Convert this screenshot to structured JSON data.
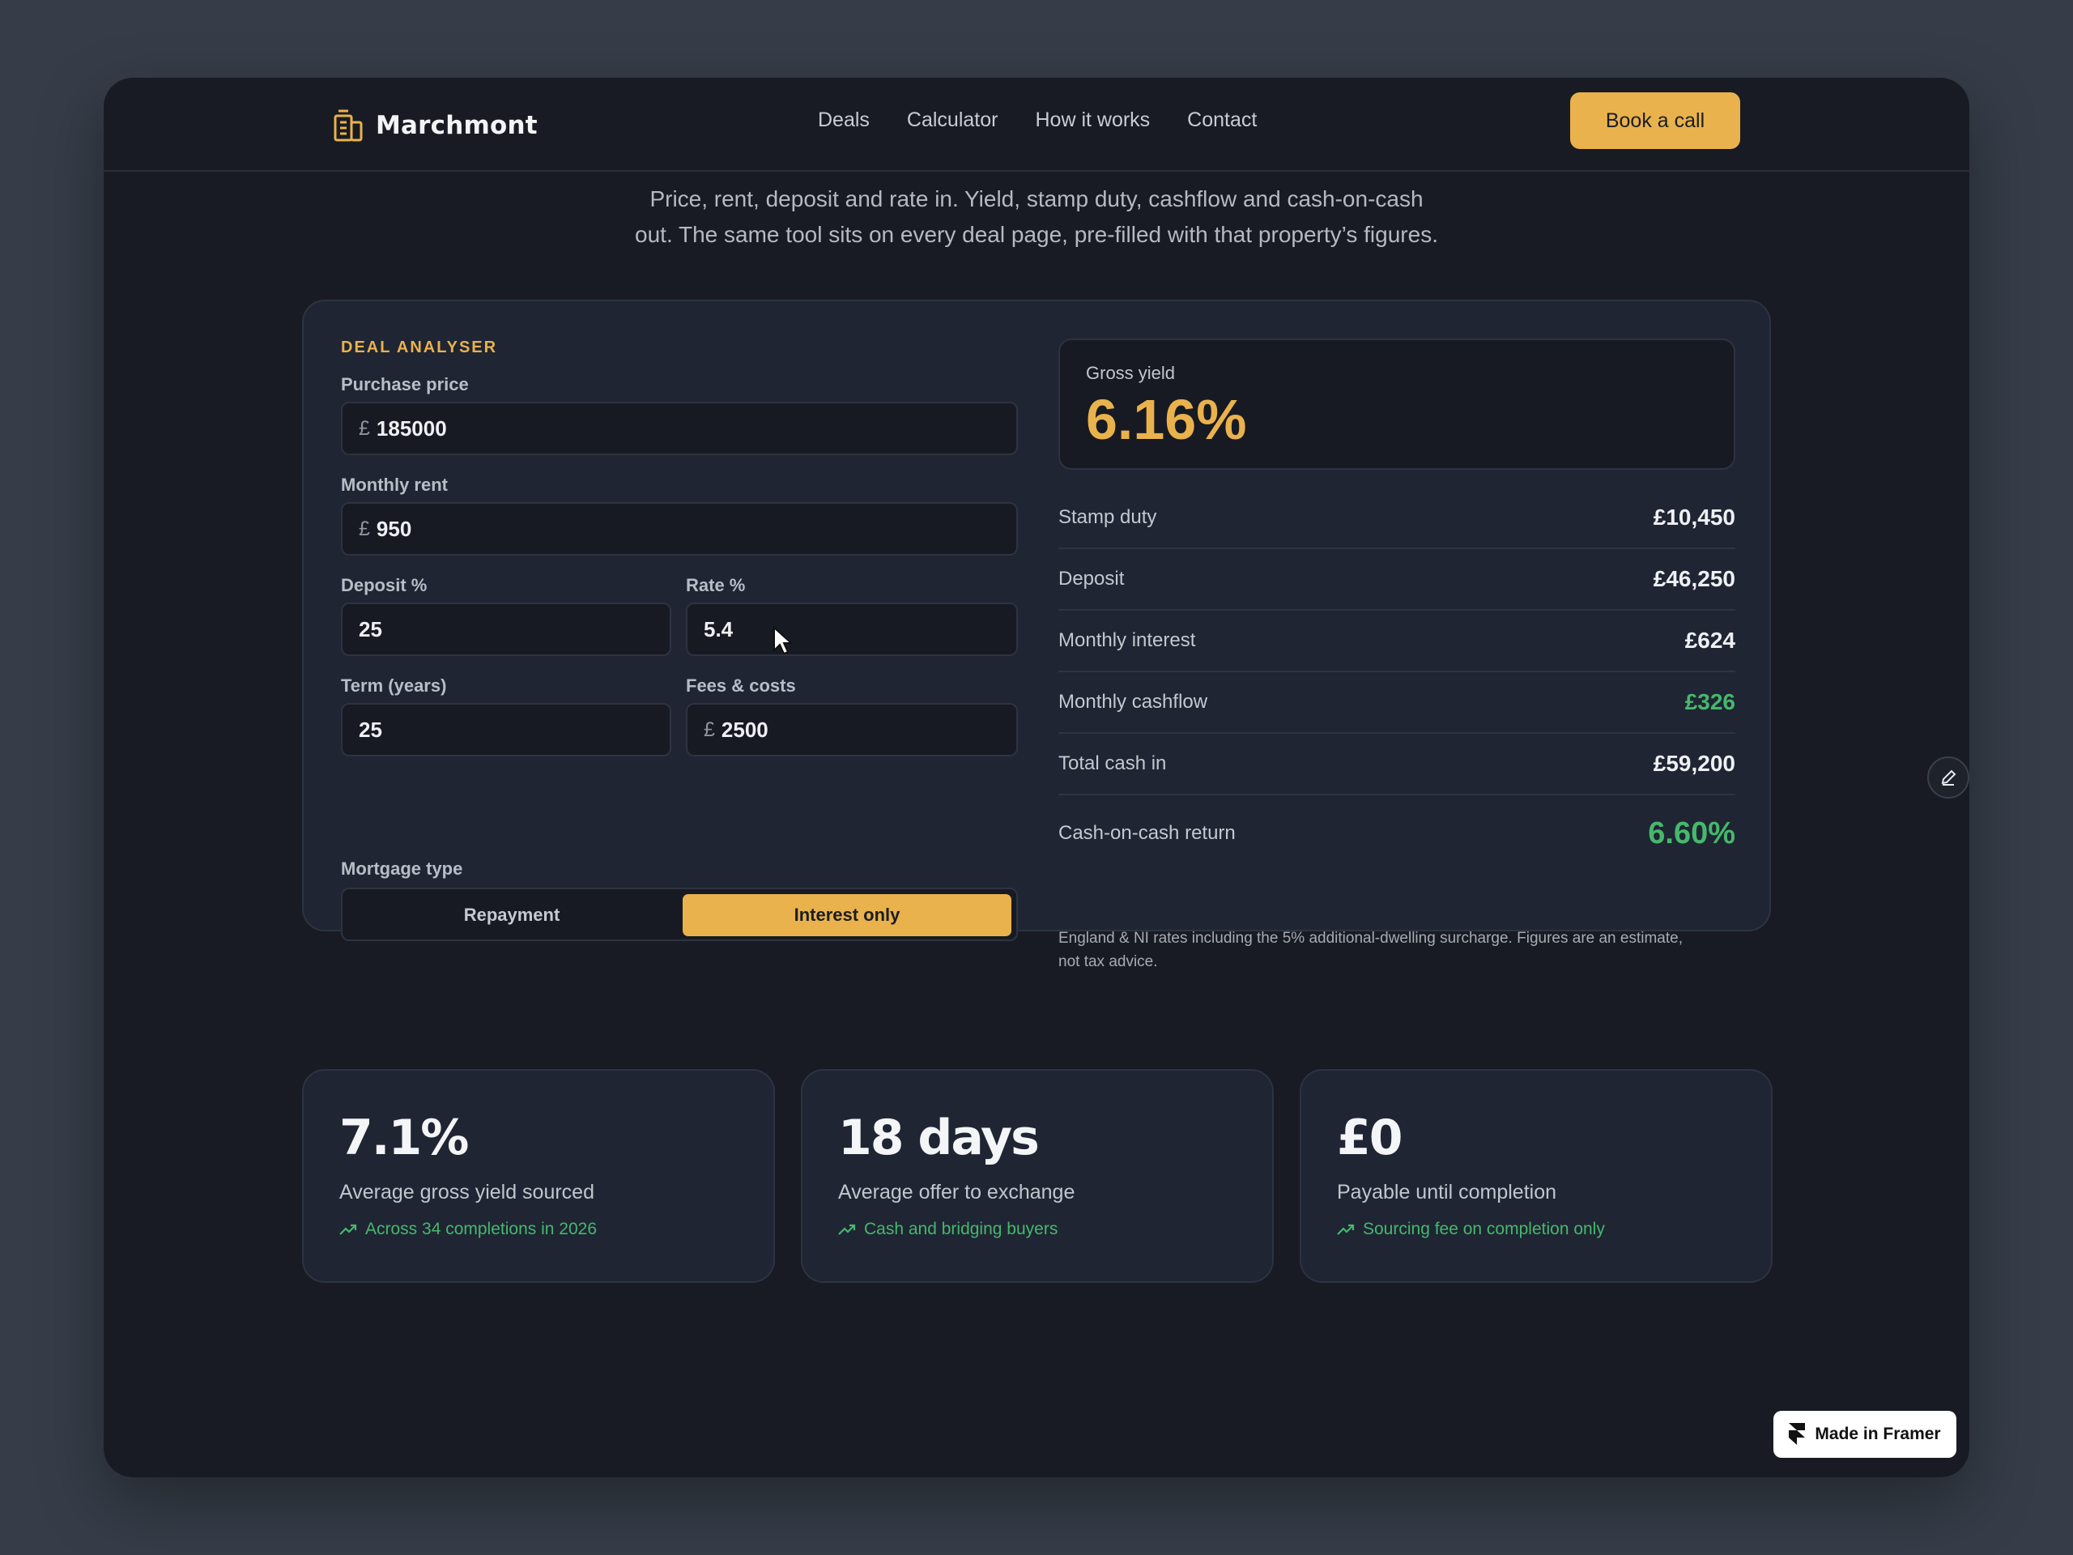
{
  "brand": {
    "name": "Marchmont",
    "icon": "building-icon"
  },
  "nav": {
    "links": [
      "Deals",
      "Calculator",
      "How it works",
      "Contact"
    ],
    "cta": "Book a call"
  },
  "intro": {
    "line1": "Price, rent, deposit and rate in. Yield, stamp duty, cashflow and cash-on-cash",
    "line2": "out. The same tool sits on every deal page, pre-filled with that property’s figures."
  },
  "analyser": {
    "label": "DEAL ANALYSER",
    "currency_symbol": "£",
    "fields": {
      "purchase_price": {
        "label": "Purchase price",
        "value": "185000"
      },
      "monthly_rent": {
        "label": "Monthly rent",
        "value": "950"
      },
      "deposit_pct": {
        "label": "Deposit %",
        "value": "25"
      },
      "rate_pct": {
        "label": "Rate %",
        "value": "5.4"
      },
      "term_years": {
        "label": "Term (years)",
        "value": "25"
      },
      "fees_costs": {
        "label": "Fees & costs",
        "value": "2500"
      }
    },
    "mortgage_type": {
      "label": "Mortgage type",
      "options": [
        "Repayment",
        "Interest only"
      ],
      "selected": "Interest only"
    },
    "results": {
      "gross_yield": {
        "label": "Gross yield",
        "value": "6.16%"
      },
      "rows": [
        {
          "label": "Stamp duty",
          "value": "£10,450"
        },
        {
          "label": "Deposit",
          "value": "£46,250"
        },
        {
          "label": "Monthly interest",
          "value": "£624"
        },
        {
          "label": "Monthly cashflow",
          "value": "£326"
        },
        {
          "label": "Total cash in",
          "value": "£59,200"
        },
        {
          "label": "Cash-on-cash return",
          "value": "6.60%"
        }
      ],
      "note": "England & NI rates including the 5% additional-dwelling surcharge. Figures are an estimate, not tax advice."
    }
  },
  "stats": [
    {
      "value": "7.1%",
      "label": "Average gross yield sourced",
      "sub": "Across 34 completions in 2026"
    },
    {
      "value": "18 days",
      "label": "Average offer to exchange",
      "sub": "Cash and bridging buyers"
    },
    {
      "value": "£0",
      "label": "Payable until completion",
      "sub": "Sourcing fee on completion only"
    }
  ],
  "badge": {
    "label": "Made in Framer",
    "icon": "framer-logo-icon"
  },
  "colors": {
    "accent": "#e9b24d",
    "positive": "#46b86c",
    "background": "#181b23",
    "card": "#1f2533"
  }
}
